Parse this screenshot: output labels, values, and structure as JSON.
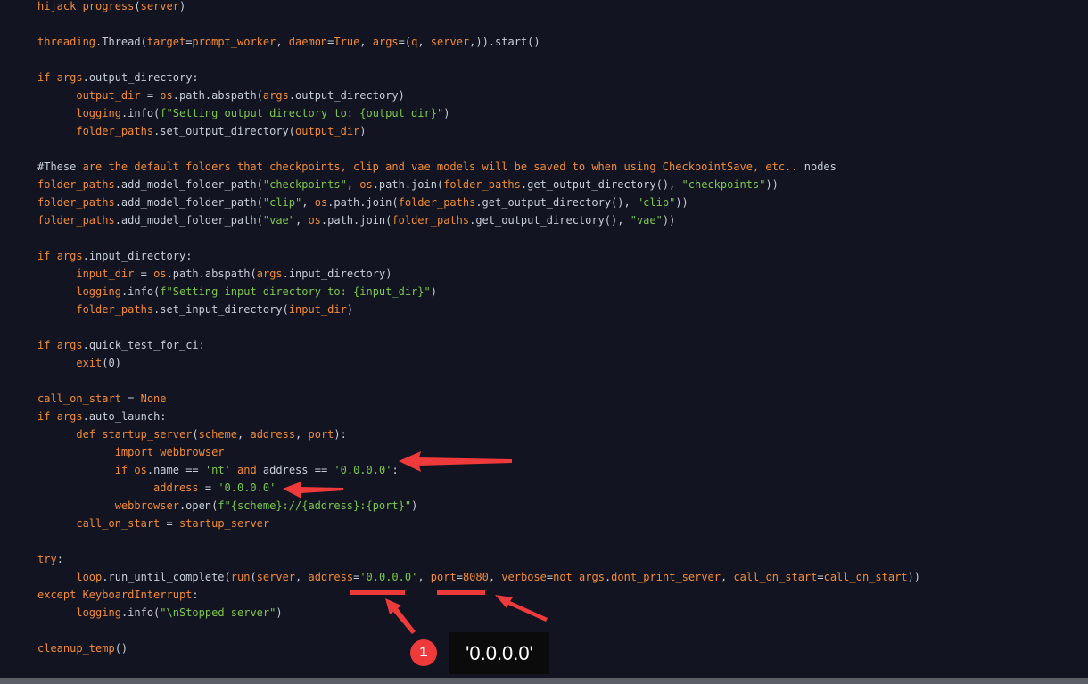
{
  "colors": {
    "background": "#121421",
    "keyword": "#f28c35",
    "string": "#7ec74b",
    "default": "#c7ced8",
    "annotation": "#ee3a3a",
    "scrollbar": "#5c5f66"
  },
  "code": {
    "lines": [
      [
        {
          "t": "i",
          "v": "hijack_progress"
        },
        {
          "t": "d",
          "v": "("
        },
        {
          "t": "i",
          "v": "server"
        },
        {
          "t": "d",
          "v": ")"
        }
      ],
      [],
      [
        {
          "t": "i",
          "v": "threading"
        },
        {
          "t": "d",
          "v": ".Thread("
        },
        {
          "t": "i",
          "v": "target"
        },
        {
          "t": "d",
          "v": "="
        },
        {
          "t": "i",
          "v": "prompt_worker"
        },
        {
          "t": "d",
          "v": ", "
        },
        {
          "t": "i",
          "v": "daemon"
        },
        {
          "t": "d",
          "v": "="
        },
        {
          "t": "k",
          "v": "True"
        },
        {
          "t": "d",
          "v": ", "
        },
        {
          "t": "i",
          "v": "args"
        },
        {
          "t": "d",
          "v": "=("
        },
        {
          "t": "i",
          "v": "q"
        },
        {
          "t": "d",
          "v": ", "
        },
        {
          "t": "i",
          "v": "server"
        },
        {
          "t": "d",
          "v": ",)).start()"
        }
      ],
      [],
      [
        {
          "t": "k",
          "v": "if "
        },
        {
          "t": "i",
          "v": "args"
        },
        {
          "t": "d",
          "v": ".output_directory:"
        }
      ],
      [
        {
          "t": "d",
          "v": "      "
        },
        {
          "t": "i",
          "v": "output_dir"
        },
        {
          "t": "d",
          "v": " = "
        },
        {
          "t": "i",
          "v": "os"
        },
        {
          "t": "d",
          "v": ".path.abspath("
        },
        {
          "t": "i",
          "v": "args"
        },
        {
          "t": "d",
          "v": ".output_directory)"
        }
      ],
      [
        {
          "t": "d",
          "v": "      "
        },
        {
          "t": "i",
          "v": "logging"
        },
        {
          "t": "d",
          "v": ".info("
        },
        {
          "t": "s",
          "v": "f\"Setting output directory to: {output_dir}\""
        },
        {
          "t": "d",
          "v": ")"
        }
      ],
      [
        {
          "t": "d",
          "v": "      "
        },
        {
          "t": "i",
          "v": "folder_paths"
        },
        {
          "t": "d",
          "v": ".set_output_directory("
        },
        {
          "t": "i",
          "v": "output_dir"
        },
        {
          "t": "d",
          "v": ")"
        }
      ],
      [],
      [
        {
          "t": "c",
          "v": "#These "
        },
        {
          "t": "k",
          "v": "are the default folders that checkpoints, clip and vae models will be saved to when using CheckpointSave, etc.."
        },
        {
          "t": "c",
          "v": " nodes"
        }
      ],
      [
        {
          "t": "i",
          "v": "folder_paths"
        },
        {
          "t": "d",
          "v": ".add_model_folder_path("
        },
        {
          "t": "s",
          "v": "\"checkpoints\""
        },
        {
          "t": "d",
          "v": ", "
        },
        {
          "t": "i",
          "v": "os"
        },
        {
          "t": "d",
          "v": ".path.join("
        },
        {
          "t": "i",
          "v": "folder_paths"
        },
        {
          "t": "d",
          "v": ".get_output_directory(), "
        },
        {
          "t": "s",
          "v": "\"checkpoints\""
        },
        {
          "t": "d",
          "v": "))"
        }
      ],
      [
        {
          "t": "i",
          "v": "folder_paths"
        },
        {
          "t": "d",
          "v": ".add_model_folder_path("
        },
        {
          "t": "s",
          "v": "\"clip\""
        },
        {
          "t": "d",
          "v": ", "
        },
        {
          "t": "i",
          "v": "os"
        },
        {
          "t": "d",
          "v": ".path.join("
        },
        {
          "t": "i",
          "v": "folder_paths"
        },
        {
          "t": "d",
          "v": ".get_output_directory(), "
        },
        {
          "t": "s",
          "v": "\"clip\""
        },
        {
          "t": "d",
          "v": "))"
        }
      ],
      [
        {
          "t": "i",
          "v": "folder_paths"
        },
        {
          "t": "d",
          "v": ".add_model_folder_path("
        },
        {
          "t": "s",
          "v": "\"vae\""
        },
        {
          "t": "d",
          "v": ", "
        },
        {
          "t": "i",
          "v": "os"
        },
        {
          "t": "d",
          "v": ".path.join("
        },
        {
          "t": "i",
          "v": "folder_paths"
        },
        {
          "t": "d",
          "v": ".get_output_directory(), "
        },
        {
          "t": "s",
          "v": "\"vae\""
        },
        {
          "t": "d",
          "v": "))"
        }
      ],
      [],
      [
        {
          "t": "k",
          "v": "if "
        },
        {
          "t": "i",
          "v": "args"
        },
        {
          "t": "d",
          "v": ".input_directory:"
        }
      ],
      [
        {
          "t": "d",
          "v": "      "
        },
        {
          "t": "i",
          "v": "input_dir"
        },
        {
          "t": "d",
          "v": " = "
        },
        {
          "t": "i",
          "v": "os"
        },
        {
          "t": "d",
          "v": ".path.abspath("
        },
        {
          "t": "i",
          "v": "args"
        },
        {
          "t": "d",
          "v": ".input_directory)"
        }
      ],
      [
        {
          "t": "d",
          "v": "      "
        },
        {
          "t": "i",
          "v": "logging"
        },
        {
          "t": "d",
          "v": ".info("
        },
        {
          "t": "s",
          "v": "f\"Setting input directory to: {input_dir}\""
        },
        {
          "t": "d",
          "v": ")"
        }
      ],
      [
        {
          "t": "d",
          "v": "      "
        },
        {
          "t": "i",
          "v": "folder_paths"
        },
        {
          "t": "d",
          "v": ".set_input_directory("
        },
        {
          "t": "i",
          "v": "input_dir"
        },
        {
          "t": "d",
          "v": ")"
        }
      ],
      [],
      [
        {
          "t": "k",
          "v": "if "
        },
        {
          "t": "i",
          "v": "args"
        },
        {
          "t": "d",
          "v": ".quick_test_for_ci:"
        }
      ],
      [
        {
          "t": "d",
          "v": "      "
        },
        {
          "t": "i",
          "v": "exit"
        },
        {
          "t": "d",
          "v": "(0)"
        }
      ],
      [],
      [
        {
          "t": "i",
          "v": "call_on_start"
        },
        {
          "t": "d",
          "v": " = "
        },
        {
          "t": "k",
          "v": "None"
        }
      ],
      [
        {
          "t": "k",
          "v": "if "
        },
        {
          "t": "i",
          "v": "args"
        },
        {
          "t": "d",
          "v": ".auto_launch:"
        }
      ],
      [
        {
          "t": "d",
          "v": "      "
        },
        {
          "t": "k",
          "v": "def "
        },
        {
          "t": "i",
          "v": "startup_server"
        },
        {
          "t": "d",
          "v": "("
        },
        {
          "t": "i",
          "v": "scheme"
        },
        {
          "t": "d",
          "v": ", "
        },
        {
          "t": "i",
          "v": "address"
        },
        {
          "t": "d",
          "v": ", "
        },
        {
          "t": "i",
          "v": "port"
        },
        {
          "t": "d",
          "v": "):"
        }
      ],
      [
        {
          "t": "d",
          "v": "            "
        },
        {
          "t": "k",
          "v": "import "
        },
        {
          "t": "i",
          "v": "webbrowser"
        }
      ],
      [
        {
          "t": "d",
          "v": "            "
        },
        {
          "t": "k",
          "v": "if "
        },
        {
          "t": "i",
          "v": "os"
        },
        {
          "t": "d",
          "v": ".name == "
        },
        {
          "t": "s",
          "v": "'nt'"
        },
        {
          "t": "d",
          "v": " "
        },
        {
          "t": "k",
          "v": "and"
        },
        {
          "t": "d",
          "v": " address == "
        },
        {
          "t": "s",
          "v": "'0.0.0.0'"
        },
        {
          "t": "d",
          "v": ":"
        }
      ],
      [
        {
          "t": "d",
          "v": "                  "
        },
        {
          "t": "i",
          "v": "address"
        },
        {
          "t": "d",
          "v": " = "
        },
        {
          "t": "s",
          "v": "'0.0.0.0'"
        }
      ],
      [
        {
          "t": "d",
          "v": "            "
        },
        {
          "t": "i",
          "v": "webbrowser"
        },
        {
          "t": "d",
          "v": ".open("
        },
        {
          "t": "s",
          "v": "f\"{scheme}://{address}:{port}\""
        },
        {
          "t": "d",
          "v": ")"
        }
      ],
      [
        {
          "t": "d",
          "v": "      "
        },
        {
          "t": "i",
          "v": "call_on_start"
        },
        {
          "t": "d",
          "v": " = "
        },
        {
          "t": "i",
          "v": "startup_server"
        }
      ],
      [],
      [
        {
          "t": "k",
          "v": "try"
        },
        {
          "t": "d",
          "v": ":"
        }
      ],
      [
        {
          "t": "d",
          "v": "      "
        },
        {
          "t": "i",
          "v": "loop"
        },
        {
          "t": "d",
          "v": ".run_until_complete("
        },
        {
          "t": "i",
          "v": "run"
        },
        {
          "t": "d",
          "v": "("
        },
        {
          "t": "i",
          "v": "server"
        },
        {
          "t": "d",
          "v": ", "
        },
        {
          "t": "i",
          "v": "address"
        },
        {
          "t": "d",
          "v": "="
        },
        {
          "t": "s",
          "v": "'0.0.0.0'"
        },
        {
          "t": "d",
          "v": ", "
        },
        {
          "t": "i",
          "v": "port"
        },
        {
          "t": "d",
          "v": "="
        },
        {
          "t": "k",
          "v": "8080"
        },
        {
          "t": "d",
          "v": ", "
        },
        {
          "t": "i",
          "v": "verbose"
        },
        {
          "t": "d",
          "v": "="
        },
        {
          "t": "k",
          "v": "not"
        },
        {
          "t": "d",
          "v": " "
        },
        {
          "t": "i",
          "v": "args"
        },
        {
          "t": "d",
          "v": "."
        },
        {
          "t": "i",
          "v": "dont_print_server"
        },
        {
          "t": "d",
          "v": ", "
        },
        {
          "t": "i",
          "v": "call_on_start"
        },
        {
          "t": "d",
          "v": "="
        },
        {
          "t": "i",
          "v": "call_on_start"
        },
        {
          "t": "d",
          "v": "))"
        }
      ],
      [
        {
          "t": "k",
          "v": "except "
        },
        {
          "t": "i",
          "v": "KeyboardInterrupt"
        },
        {
          "t": "d",
          "v": ":"
        }
      ],
      [
        {
          "t": "d",
          "v": "      "
        },
        {
          "t": "i",
          "v": "logging"
        },
        {
          "t": "d",
          "v": ".info("
        },
        {
          "t": "s",
          "v": "\"\\nStopped server\""
        },
        {
          "t": "d",
          "v": ")"
        }
      ],
      [],
      [
        {
          "t": "i",
          "v": "cleanup_temp"
        },
        {
          "t": "d",
          "v": "()"
        }
      ]
    ]
  },
  "annotation": {
    "badge_number": "1",
    "tooltip_text": "'0.0.0.0'"
  }
}
